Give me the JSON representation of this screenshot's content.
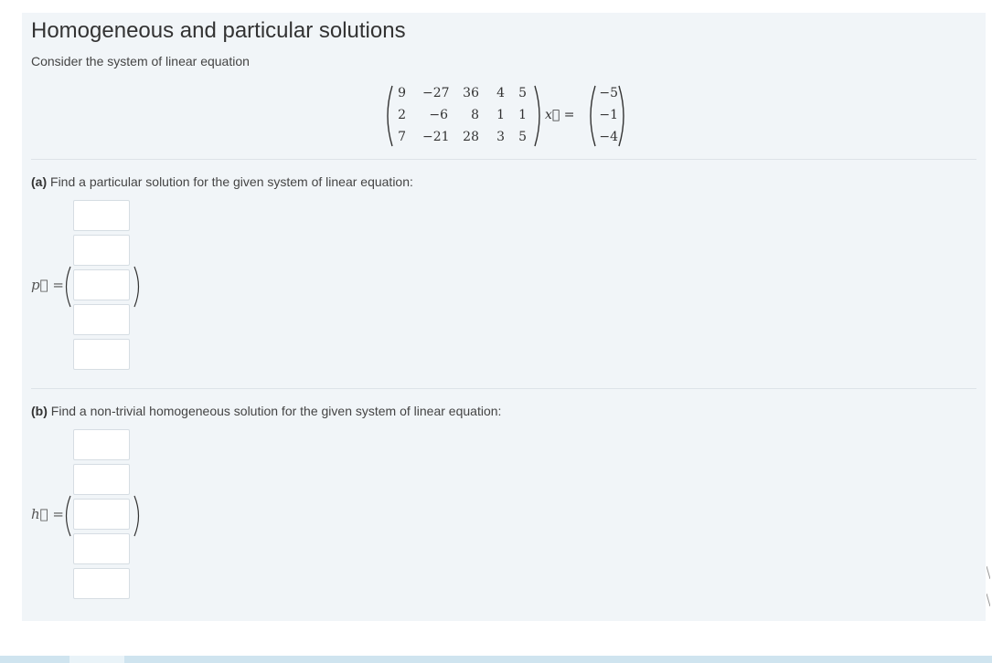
{
  "title": "Homogeneous and particular solutions",
  "intro": "Consider the system of linear equation",
  "system": {
    "matrix": [
      [
        "9",
        "−27",
        "36",
        "4",
        "5"
      ],
      [
        "2",
        "−6",
        "8",
        "1",
        "1"
      ],
      [
        "7",
        "−21",
        "28",
        "3",
        "5"
      ]
    ],
    "variable": "x⃗ =",
    "rhs": [
      "−5",
      "−1",
      "−4"
    ]
  },
  "part_a": {
    "letter": "(a)",
    "text": "Find a particular solution for the given system of linear equation:",
    "vector_label": "p⃗ =",
    "inputs": [
      "",
      "",
      "",
      "",
      ""
    ]
  },
  "part_b": {
    "letter": "(b)",
    "text": "Find a non-trivial homogeneous solution for the given system of linear equation:",
    "vector_label": "h⃗ =",
    "inputs": [
      "",
      "",
      "",
      "",
      ""
    ]
  }
}
